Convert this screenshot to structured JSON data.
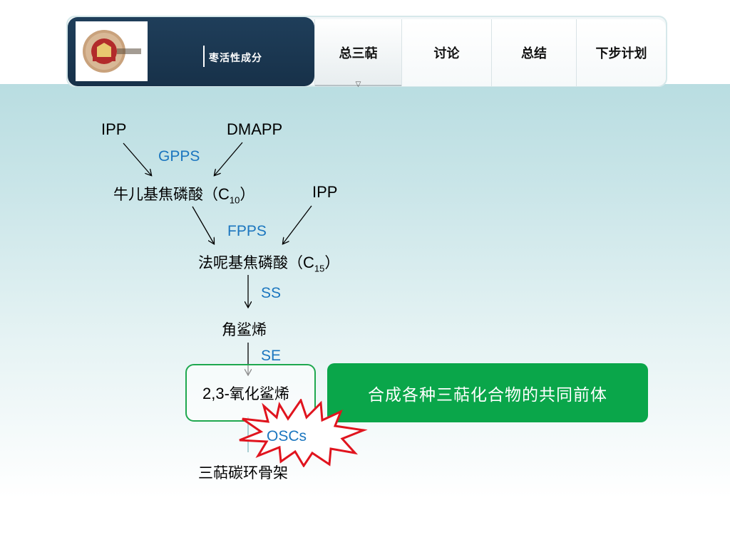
{
  "header": {
    "brand_title": "枣活性成分",
    "tabs": [
      {
        "label": "总三萜",
        "active": true
      },
      {
        "label": "讨论",
        "active": false
      },
      {
        "label": "总结",
        "active": false
      },
      {
        "label": "下步计划",
        "active": false
      }
    ],
    "colors": {
      "brand_bg": "#1f3e5a",
      "accent_green": "#0aa64a",
      "enzyme_blue": "#1b76bf",
      "burst_red": "#e0141e"
    }
  },
  "diagram": {
    "ipp_top": "IPP",
    "dmapp": "DMAPP",
    "enzyme_gpps": "GPPS",
    "gpp_name": "牛儿基焦磷酸（",
    "gpp_c": "C",
    "gpp_sub": "10",
    "gpp_close": "）",
    "ipp_mid": "IPP",
    "enzyme_fpps": "FPPS",
    "fpp_name": "法呢基焦磷酸（",
    "fpp_c": "C",
    "fpp_sub": "15",
    "fpp_close": "）",
    "enzyme_ss": "SS",
    "squalene": "角鲨烯",
    "enzyme_se": "SE",
    "oxido_prefix": "2,3-",
    "oxido_name": "氧化鲨烯",
    "enzyme_oscs": "OSCs",
    "skeleton": "三萜碳环骨架",
    "callout": "合成各种三萜化合物的共同前体"
  }
}
